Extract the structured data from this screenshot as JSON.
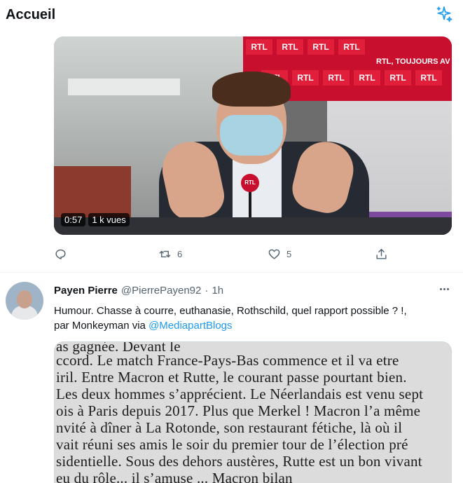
{
  "header": {
    "title": "Accueil",
    "sparkle_icon": "sparkle-icon",
    "accent": "#1d9bf0"
  },
  "video": {
    "duration": "0:57",
    "views": "1 k vues",
    "banner": "RTL, TOUJOURS AV",
    "wall_tile": "RTL",
    "mic_label": "RTL"
  },
  "first_tweet_actions": {
    "reply_count": "",
    "retweet_count": "6",
    "like_count": "5"
  },
  "second_tweet": {
    "author_name": "Payen Pierre",
    "author_handle": "@PierrePayen92",
    "separator": "·",
    "time": "1h",
    "text_line1": "Humour. Chasse à courre, euthanasie, Rothschild, quel rapport possible ? !,",
    "text_line2_prefix": "par Monkeyman via ",
    "mention": "@MediapartBlogs",
    "scan_lines": [
      "as gagnée. Devant le",
      "ccord. Le match France-Pays-Bas commence et il va etre",
      "iril. Entre Macron et Rutte, le courant passe pourtant bien.",
      "Les deux hommes s’apprécient. Le Néerlandais est venu sept",
      "ois à Paris depuis 2017. Plus que Merkel ! Macron l’a même",
      "nvité à dîner à La Rotonde, son restaurant fétiche, là où il",
      "vait réuni ses amis le soir du premier tour de l’élection pré",
      "sidentielle. Sous des dehors austères, Rutte est un bon vivant",
      "eu du rôle... il s’amuse ... Macron bilan"
    ]
  }
}
